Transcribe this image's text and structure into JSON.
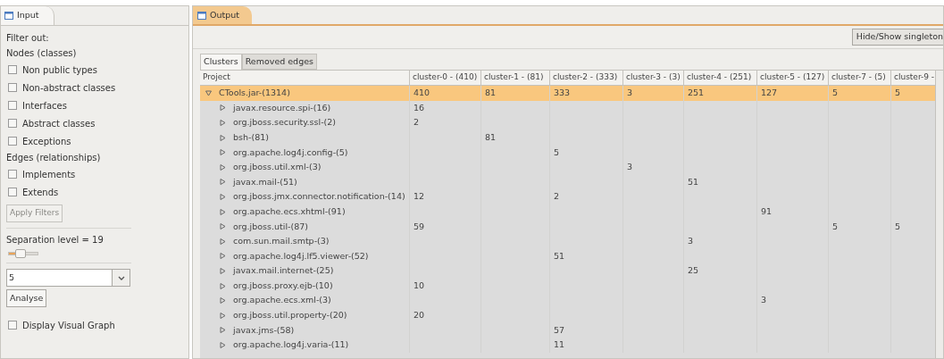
{
  "input_view": {
    "tab": {
      "label": "Input"
    },
    "filter_label": "Filter out:",
    "groups": [
      {
        "title": "Nodes (classes)",
        "options": [
          {
            "label": "Non public types",
            "checked": false
          },
          {
            "label": "Non-abstract classes",
            "checked": false
          },
          {
            "label": "Interfaces",
            "checked": false
          },
          {
            "label": "Abstract classes",
            "checked": false
          },
          {
            "label": "Exceptions",
            "checked": false
          }
        ]
      },
      {
        "title": "Edges (relationships)",
        "options": [
          {
            "label": "Implements",
            "checked": false
          },
          {
            "label": "Extends",
            "checked": false
          }
        ]
      }
    ],
    "apply_button": {
      "label": "Apply Filters",
      "disabled": true
    },
    "separation": {
      "label": "Separation level = 19",
      "level": 0.3
    },
    "combo": {
      "value": "5"
    },
    "analyse_button": {
      "label": "Analyse"
    },
    "display_graph": {
      "label": "Display Visual Graph",
      "checked": false
    }
  },
  "output_view": {
    "tab": {
      "label": "Output"
    },
    "toolbar_button": "Hide/Show singleton",
    "tabs": [
      {
        "label": "Clusters",
        "selected": true
      },
      {
        "label": "Removed edges",
        "selected": false
      }
    ],
    "table": {
      "columns": [
        "Project",
        "cluster-0 - (410)",
        "cluster-1 - (81)",
        "cluster-2 - (333)",
        "cluster-3 - (3)",
        "cluster-4 - (251)",
        "cluster-5 - (127)",
        "cluster-7 - (5)",
        "cluster-9 -"
      ],
      "rows": [
        {
          "expanded": true,
          "selected": true,
          "cells": [
            "CTools.jar-(1314)",
            "410",
            "81",
            "333",
            "3",
            "251",
            "127",
            "5",
            "5"
          ],
          "children": [
            {
              "expanded": false,
              "selected": false,
              "cells": [
                "javax.resource.spi-(16)",
                "16",
                "",
                "",
                "",
                "",
                "",
                "",
                ""
              ]
            },
            {
              "expanded": false,
              "selected": false,
              "cells": [
                "org.jboss.security.ssl-(2)",
                "2",
                "",
                "",
                "",
                "",
                "",
                "",
                ""
              ]
            },
            {
              "expanded": false,
              "selected": false,
              "cells": [
                "bsh-(81)",
                "",
                "81",
                "",
                "",
                "",
                "",
                "",
                ""
              ]
            },
            {
              "expanded": false,
              "selected": false,
              "cells": [
                "org.apache.log4j.config-(5)",
                "",
                "",
                "5",
                "",
                "",
                "",
                "",
                ""
              ]
            },
            {
              "expanded": false,
              "selected": false,
              "cells": [
                "org.jboss.util.xml-(3)",
                "",
                "",
                "",
                "3",
                "",
                "",
                "",
                ""
              ]
            },
            {
              "expanded": false,
              "selected": false,
              "cells": [
                "javax.mail-(51)",
                "",
                "",
                "",
                "",
                "51",
                "",
                "",
                ""
              ]
            },
            {
              "expanded": false,
              "selected": false,
              "cells": [
                "org.jboss.jmx.connector.notification-(14)",
                "12",
                "",
                "2",
                "",
                "",
                "",
                "",
                ""
              ]
            },
            {
              "expanded": false,
              "selected": false,
              "cells": [
                "org.apache.ecs.xhtml-(91)",
                "",
                "",
                "",
                "",
                "",
                "91",
                "",
                ""
              ]
            },
            {
              "expanded": false,
              "selected": false,
              "cells": [
                "org.jboss.util-(87)",
                "59",
                "",
                "",
                "",
                "",
                "",
                "5",
                "5"
              ]
            },
            {
              "expanded": false,
              "selected": false,
              "cells": [
                "com.sun.mail.smtp-(3)",
                "",
                "",
                "",
                "",
                "3",
                "",
                "",
                ""
              ]
            },
            {
              "expanded": false,
              "selected": false,
              "cells": [
                "org.apache.log4j.lf5.viewer-(52)",
                "",
                "",
                "51",
                "",
                "",
                "",
                "",
                ""
              ]
            },
            {
              "expanded": false,
              "selected": false,
              "cells": [
                "javax.mail.internet-(25)",
                "",
                "",
                "",
                "",
                "25",
                "",
                "",
                ""
              ]
            },
            {
              "expanded": false,
              "selected": false,
              "cells": [
                "org.jboss.proxy.ejb-(10)",
                "10",
                "",
                "",
                "",
                "",
                "",
                "",
                ""
              ]
            },
            {
              "expanded": false,
              "selected": false,
              "cells": [
                "org.apache.ecs.xml-(3)",
                "",
                "",
                "",
                "",
                "",
                "3",
                "",
                ""
              ]
            },
            {
              "expanded": false,
              "selected": false,
              "cells": [
                "org.jboss.util.property-(20)",
                "20",
                "",
                "",
                "",
                "",
                "",
                "",
                ""
              ]
            },
            {
              "expanded": false,
              "selected": false,
              "cells": [
                "javax.jms-(58)",
                "",
                "",
                "57",
                "",
                "",
                "",
                "",
                ""
              ]
            },
            {
              "expanded": false,
              "selected": false,
              "cells": [
                "org.apache.log4j.varia-(11)",
                "",
                "",
                "11",
                "",
                "",
                "",
                "",
                ""
              ]
            }
          ]
        }
      ]
    }
  }
}
